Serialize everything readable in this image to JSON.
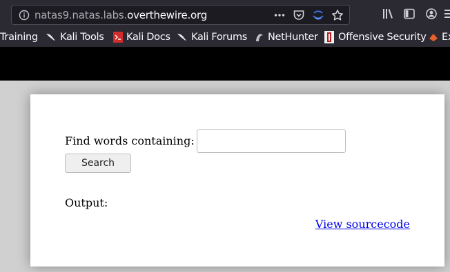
{
  "browser": {
    "url_prefix": "natas9.natas.labs.",
    "url_host": "overthewire.org",
    "bookmarks": [
      {
        "label": "Training",
        "icon": "training-icon"
      },
      {
        "label": "Kali Tools",
        "icon": "kali-dragon-icon"
      },
      {
        "label": "Kali Docs",
        "icon": "kali-docs-icon"
      },
      {
        "label": "Kali Forums",
        "icon": "kali-dragon-icon"
      },
      {
        "label": "NetHunter",
        "icon": "nethunter-icon"
      },
      {
        "label": "Offensive Security",
        "icon": "offsec-icon"
      },
      {
        "label": "Ex",
        "icon": "exploit-db-icon"
      }
    ]
  },
  "page": {
    "find_label": "Find words containing:",
    "search_value": "",
    "search_button": "Search",
    "output_label": "Output:",
    "source_link": "View sourcecode"
  },
  "colors": {
    "toolbar_bg": "#2b2a33",
    "page_bg": "#d0d0d0",
    "link": "#0000ee"
  }
}
